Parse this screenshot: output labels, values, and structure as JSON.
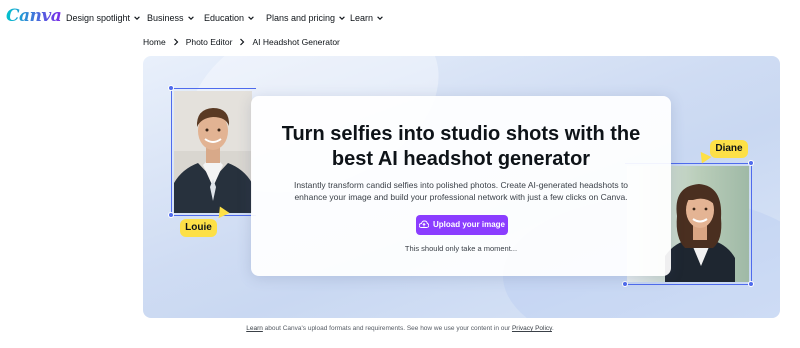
{
  "brand": {
    "logo_text": "Canva"
  },
  "nav": {
    "items": [
      {
        "label": "Design spotlight"
      },
      {
        "label": "Business"
      },
      {
        "label": "Education"
      },
      {
        "label": "Plans and pricing"
      },
      {
        "label": "Learn"
      }
    ]
  },
  "breadcrumb": {
    "items": [
      {
        "label": "Home"
      },
      {
        "label": "Photo Editor"
      },
      {
        "label": "AI Headshot Generator"
      }
    ]
  },
  "hero": {
    "headline_line1": "Turn selfies into studio shots with the",
    "headline_line2": "best AI headshot generator",
    "subtext_line1": "Instantly transform candid selfies into polished photos. Create AI-generated headshots to",
    "subtext_line2": "enhance your image and build your professional network with just a few clicks on Canva.",
    "upload_label": "Upload your image",
    "note": "This should only take a moment...",
    "left_tag": "Louie",
    "right_tag": "Diane"
  },
  "footer": {
    "learn_link": "Learn",
    "text_middle": " about Canva's upload formats and requirements. See how we use your content in our ",
    "privacy_link": "Privacy Policy",
    "text_end": "."
  },
  "colors": {
    "accent": "#8b3dff",
    "selection": "#4f6bed",
    "tag": "#fde047"
  }
}
